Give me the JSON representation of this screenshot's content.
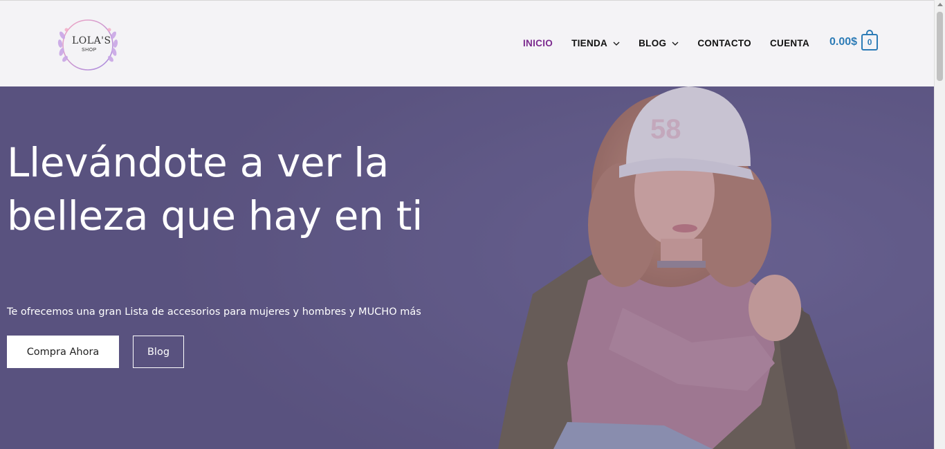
{
  "logo": {
    "brand_text": "LOLA'S",
    "sub_text": "SHOP",
    "icon": "floral-wreath-logo"
  },
  "nav": {
    "items": [
      {
        "label": "INICIO",
        "active": true,
        "has_dropdown": false
      },
      {
        "label": "TIENDA",
        "active": false,
        "has_dropdown": true
      },
      {
        "label": "BLOG",
        "active": false,
        "has_dropdown": true
      },
      {
        "label": "CONTACTO",
        "active": false,
        "has_dropdown": false
      },
      {
        "label": "CUENTA",
        "active": false,
        "has_dropdown": false
      }
    ]
  },
  "cart": {
    "total": "0.00$",
    "count": "0",
    "icon": "shopping-bag-icon"
  },
  "hero": {
    "title": "Llevándote a ver la belleza que hay en ti",
    "subtitle": "Te ofrecemos una gran Lista de accesorios para mujeres y hombres y MUCHO más",
    "primary_button": "Compra Ahora",
    "secondary_button": "Blog",
    "image": "woman-in-cap-pink-sweater-olive-jacket"
  },
  "colors": {
    "header_bg": "#f4f3f6",
    "hero_overlay": "#5d5683",
    "active_nav": "#7b2a8e",
    "cart_accent": "#2c7bb6",
    "button_bg": "#ffffff"
  }
}
